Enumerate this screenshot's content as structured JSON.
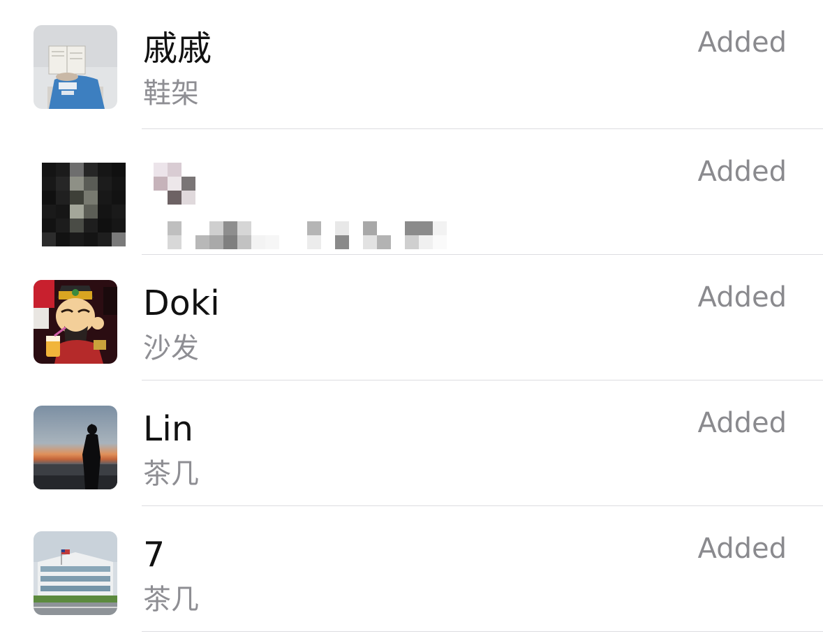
{
  "contacts": [
    {
      "name": "戚戚",
      "subtitle": "鞋架",
      "status": "Added",
      "avatar": "photo-person-reading-avatar",
      "redacted": false
    },
    {
      "name": "",
      "subtitle": "",
      "status": "Added",
      "avatar": "pixelated-avatar",
      "redacted": true
    },
    {
      "name": "Doki",
      "subtitle": "沙发",
      "status": "Added",
      "avatar": "cartoon-deity-avatar",
      "redacted": false
    },
    {
      "name": "Lin",
      "subtitle": "茶几",
      "status": "Added",
      "avatar": "sunset-silhouette-avatar",
      "redacted": false
    },
    {
      "name": "7",
      "subtitle": "茶几",
      "status": "Added",
      "avatar": "office-building-avatar",
      "redacted": false
    }
  ]
}
